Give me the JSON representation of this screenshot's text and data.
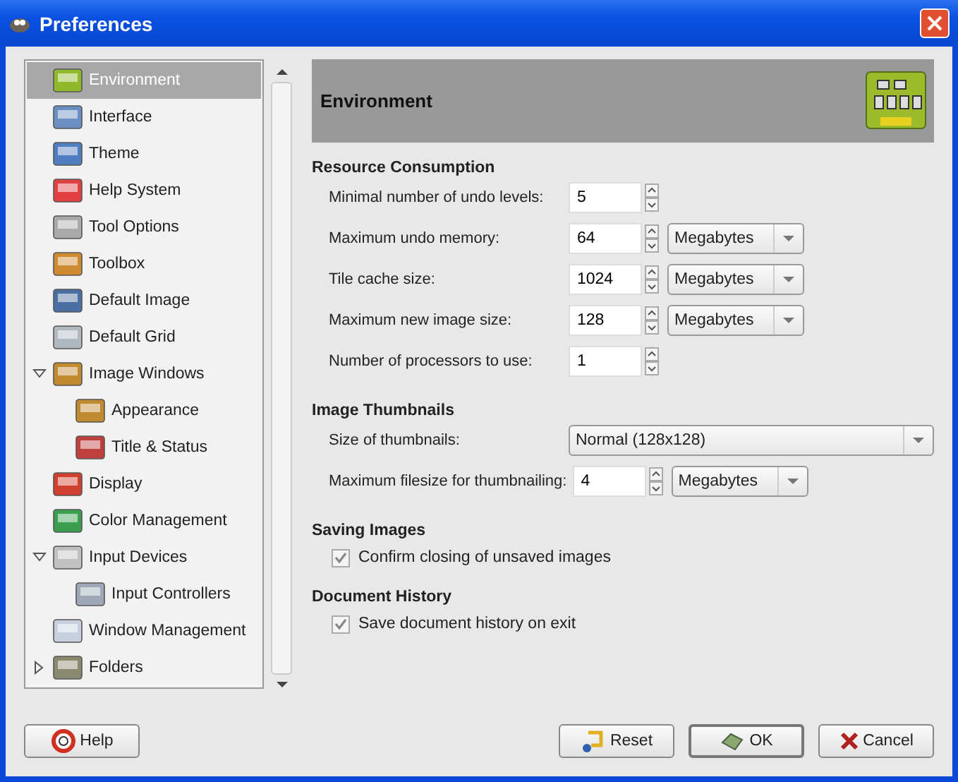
{
  "window": {
    "title": "Preferences"
  },
  "sidebar": {
    "items": [
      {
        "label": "Environment",
        "selected": true
      },
      {
        "label": "Interface",
        "selected": false
      },
      {
        "label": "Theme",
        "selected": false
      },
      {
        "label": "Help System",
        "selected": false
      },
      {
        "label": "Tool Options",
        "selected": false
      },
      {
        "label": "Toolbox",
        "selected": false
      },
      {
        "label": "Default Image",
        "selected": false
      },
      {
        "label": "Default Grid",
        "selected": false
      },
      {
        "label": "Image Windows",
        "selected": false,
        "expanded": true,
        "children": [
          {
            "label": "Appearance",
            "selected": false
          },
          {
            "label": "Title & Status",
            "selected": false
          }
        ]
      },
      {
        "label": "Display",
        "selected": false
      },
      {
        "label": "Color Management",
        "selected": false
      },
      {
        "label": "Input Devices",
        "selected": false,
        "expanded": true,
        "children": [
          {
            "label": "Input Controllers",
            "selected": false
          }
        ]
      },
      {
        "label": "Window Management",
        "selected": false
      },
      {
        "label": "Folders",
        "selected": false,
        "expanded": false
      }
    ]
  },
  "header": {
    "title": "Environment"
  },
  "sections": [
    {
      "title": "Resource Consumption",
      "rows": [
        {
          "kind": "spin",
          "label": "Minimal number of undo levels:",
          "value": "5"
        },
        {
          "kind": "spin-unit",
          "label": "Maximum undo memory:",
          "value": "64",
          "unit": "Megabytes"
        },
        {
          "kind": "spin-unit",
          "label": "Tile cache size:",
          "value": "1024",
          "unit": "Megabytes"
        },
        {
          "kind": "spin-unit",
          "label": "Maximum new image size:",
          "value": "128",
          "unit": "Megabytes"
        },
        {
          "kind": "spin",
          "label": "Number of processors to use:",
          "value": "1"
        }
      ]
    },
    {
      "title": "Image Thumbnails",
      "rows": [
        {
          "kind": "combo",
          "label": "Size of thumbnails:",
          "value": "Normal (128x128)"
        },
        {
          "kind": "spin-unit",
          "label": "Maximum filesize for thumbnailing:",
          "value": "4",
          "unit": "Megabytes"
        }
      ]
    },
    {
      "title": "Saving Images",
      "rows": [
        {
          "kind": "check",
          "label": "Confirm closing of unsaved images",
          "checked": true
        }
      ]
    },
    {
      "title": "Document History",
      "rows": [
        {
          "kind": "check",
          "label": "Save document history on exit",
          "checked": true
        }
      ]
    }
  ],
  "buttons": [
    {
      "kind": "help",
      "label": "Help",
      "default": false
    },
    {
      "kind": "reset",
      "label": "Reset",
      "default": false
    },
    {
      "kind": "ok",
      "label": "OK",
      "default": true
    },
    {
      "kind": "cancel",
      "label": "Cancel",
      "default": false
    }
  ]
}
